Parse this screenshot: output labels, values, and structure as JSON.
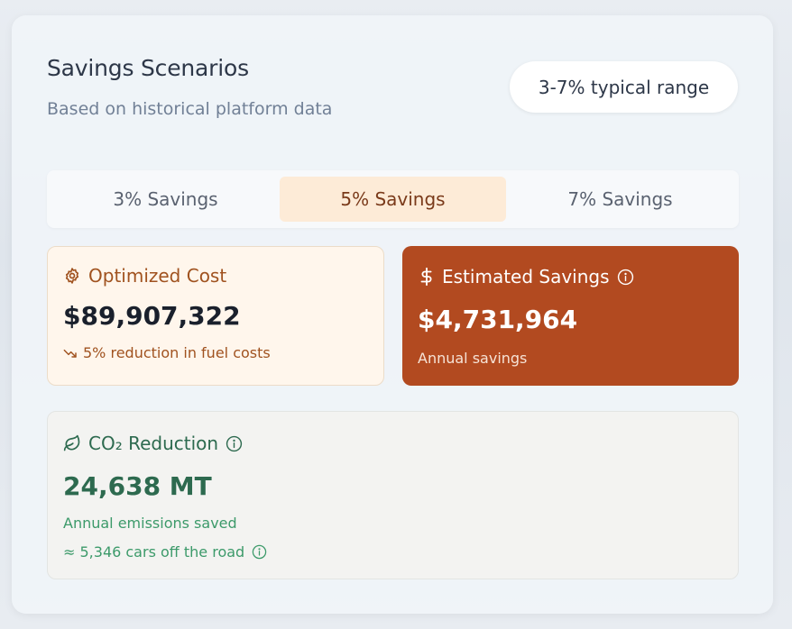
{
  "header": {
    "title": "Savings Scenarios",
    "subtitle": "Based on historical platform data",
    "range_label": "3-7% typical range"
  },
  "tabs": [
    {
      "label": "3% Savings",
      "selected": false
    },
    {
      "label": "5% Savings",
      "selected": true
    },
    {
      "label": "7% Savings",
      "selected": false
    }
  ],
  "optimized_cost": {
    "label": "Optimized Cost",
    "value": "$89,907,322",
    "note": "5% reduction in fuel costs",
    "icon": "gear-icon"
  },
  "estimated_savings": {
    "label": "Estimated Savings",
    "value": "$4,731,964",
    "note": "Annual savings",
    "icon": "dollar-icon"
  },
  "co2": {
    "label": "CO₂ Reduction",
    "value": "24,638 MT",
    "note": "Annual emissions saved",
    "equivalent": "≈ 5,346 cars off the road",
    "icon": "leaf-icon"
  },
  "colors": {
    "accent_orange": "#b24a20",
    "cost_text": "#a0521f",
    "green": "#2d6a4f",
    "green_light": "#3c9a6a"
  }
}
